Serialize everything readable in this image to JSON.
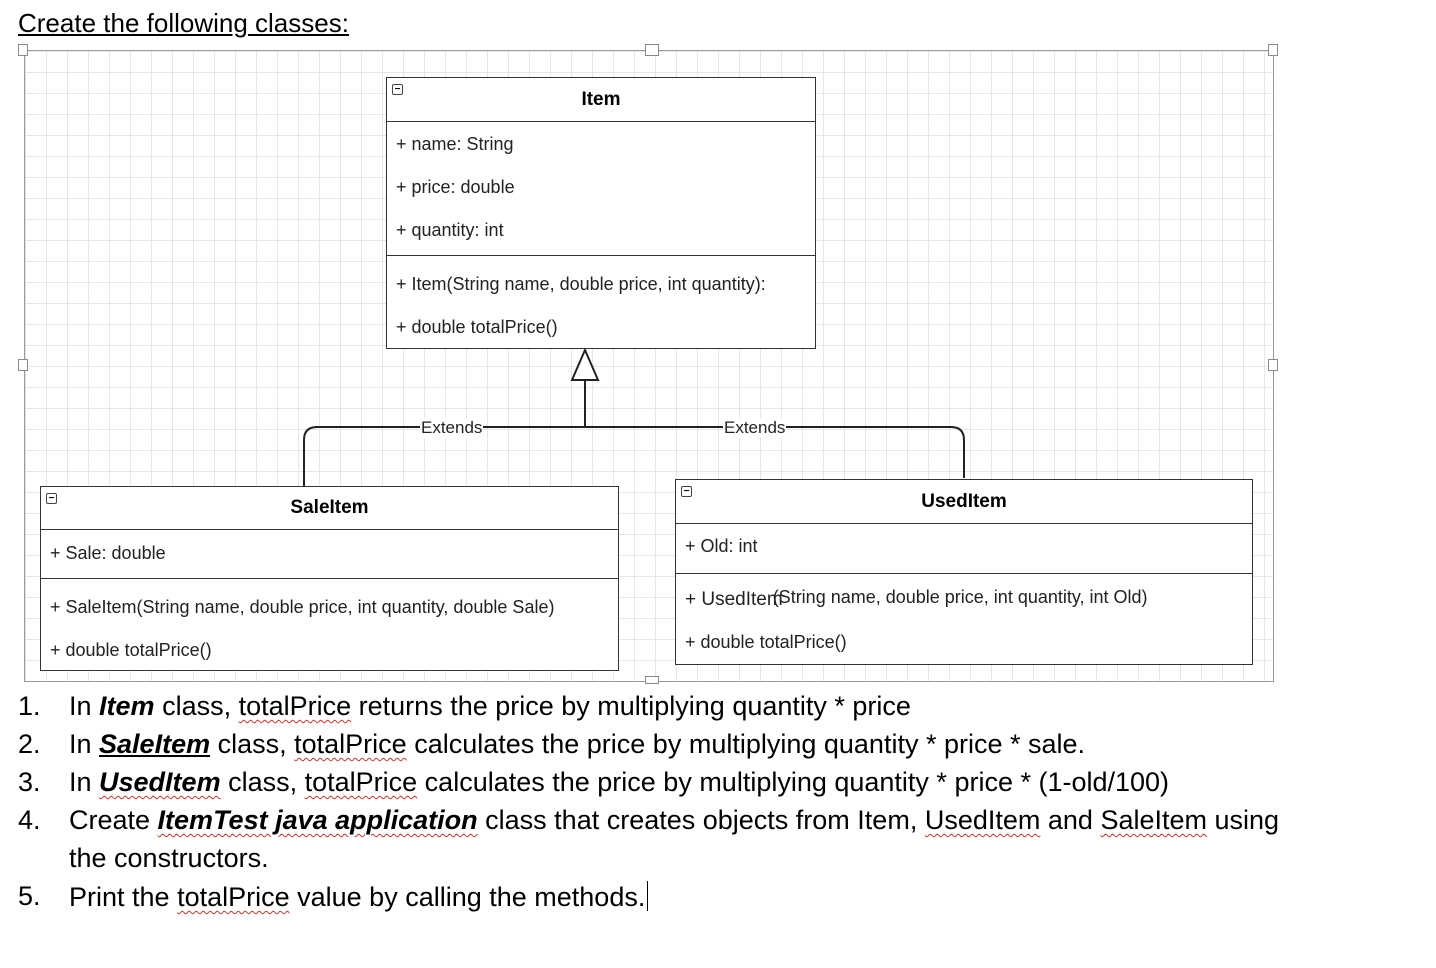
{
  "heading": "Create the following classes:",
  "diagram": {
    "item": {
      "title": "Item",
      "attributes": [
        "+ name: String",
        "+ price: double",
        "+ quantity: int"
      ],
      "methods": [
        "+ Item(String name, double price, int quantity):",
        "+ double totalPrice()"
      ]
    },
    "saleitem": {
      "title": "SaleItem",
      "attributes": [
        "+ Sale: double"
      ],
      "methods": [
        "+ SaleItem(String name, double price, int quantity, double Sale)",
        "+ double totalPrice()"
      ]
    },
    "useditem": {
      "title": "UsedItem",
      "attributes": [
        "+ Old: int"
      ],
      "method_prefix": "+ UsedItem",
      "method_rest": "(String name, double price, int quantity, int Old)",
      "methods_2": "+ double totalPrice()"
    },
    "extends_left": "Extends",
    "extends_right": "Extends",
    "collapse_symbol": "−"
  },
  "instructions": {
    "n1": "1.",
    "n2": "2.",
    "n3": "3.",
    "n4": "4.",
    "n5": "5.",
    "i1a": "In ",
    "i1b": "Item",
    "i1c": " class, ",
    "i1d": "totalPrice",
    "i1e": " returns the price by multiplying quantity * price",
    "i2a": "In ",
    "i2b": "SaleItem",
    "i2c": " class, ",
    "i2d": "totalPrice",
    "i2e": " calculates the price by multiplying quantity * price * sale.",
    "i3a": "In ",
    "i3b": "UsedItem",
    "i3c": " class, ",
    "i3d": "totalPrice",
    "i3e": " calculates the price by multiplying quantity * price * (1-old/100)",
    "i4a": "Create ",
    "i4b": "ItemTest java application",
    "i4c": " class that creates objects from Item, ",
    "i4d": "UsedItem",
    "i4e": " and ",
    "i4f": "SaleItem",
    "i4g": " using",
    "i4h": "the constructors.",
    "i5a": "Print the ",
    "i5b": "totalPrice",
    "i5c": " value by calling the methods."
  }
}
